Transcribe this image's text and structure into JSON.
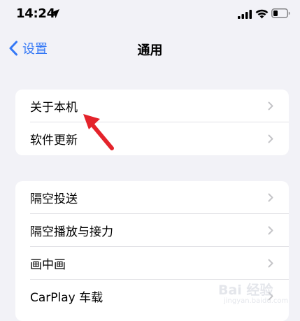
{
  "status_bar": {
    "time": "14:24"
  },
  "nav": {
    "back_label": "设置",
    "title": "通用"
  },
  "groups": [
    {
      "items": [
        {
          "label": "关于本机"
        },
        {
          "label": "软件更新"
        }
      ]
    },
    {
      "items": [
        {
          "label": "隔空投送"
        },
        {
          "label": "隔空播放与接力"
        },
        {
          "label": "画中画"
        },
        {
          "label": "CarPlay 车载"
        }
      ]
    }
  ],
  "annotation": {
    "arrow_color": "#e4232b"
  },
  "watermark": {
    "logo_text": "Bai 经验",
    "url": "jingyan.baidu.com"
  },
  "colors": {
    "accent": "#3478f6",
    "background": "#f2f2f7",
    "chevron": "#c4c4c7"
  }
}
